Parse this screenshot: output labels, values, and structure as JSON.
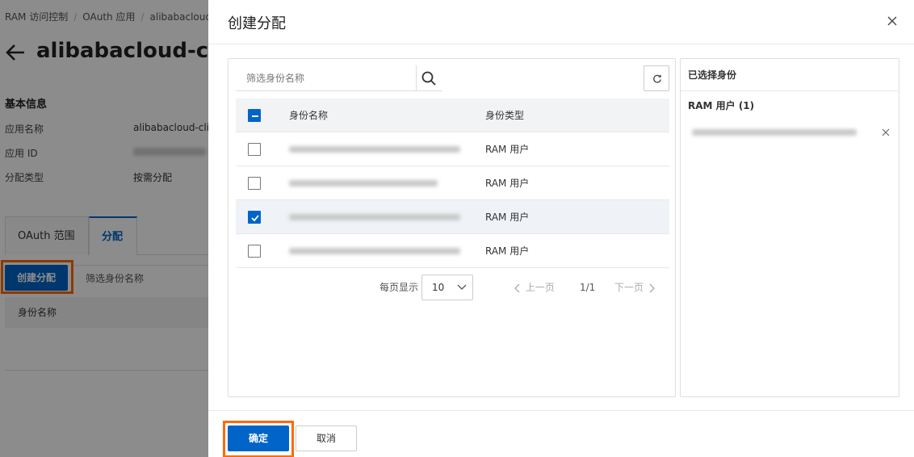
{
  "background": {
    "breadcrumb": [
      "RAM 访问控制",
      "OAuth 应用",
      "alibabacloud-"
    ],
    "page_title": "alibabacloud-cli@",
    "section_title": "基本信息",
    "info": [
      {
        "label": "应用名称",
        "value": "alibabacloud-cli@"
      },
      {
        "label": "应用 ID",
        "value": ""
      },
      {
        "label": "分配类型",
        "value": "按需分配"
      }
    ],
    "tabs": [
      "OAuth 范围",
      "分配"
    ],
    "create_button": "创建分配",
    "filter_placeholder": "筛选身份名称",
    "table_header": "身份名称"
  },
  "drawer": {
    "title": "创建分配",
    "search_placeholder": "筛选身份名称",
    "table": {
      "headers": {
        "name": "身份名称",
        "type": "身份类型"
      },
      "rows": [
        {
          "type": "RAM 用户",
          "checked": false
        },
        {
          "type": "RAM 用户",
          "checked": false
        },
        {
          "type": "RAM 用户",
          "checked": true
        },
        {
          "type": "RAM 用户",
          "checked": false
        }
      ]
    },
    "pagination": {
      "per_page_label": "每页显示",
      "per_page_value": "10",
      "prev": "上一页",
      "page_indicator": "1/1",
      "next": "下一页"
    },
    "selected_panel": {
      "title": "已选择身份",
      "group_label": "RAM 用户 (1)"
    },
    "footer": {
      "ok": "确定",
      "cancel": "取消"
    }
  },
  "colors": {
    "primary": "#0064c8",
    "highlight": "#ff6a00"
  }
}
